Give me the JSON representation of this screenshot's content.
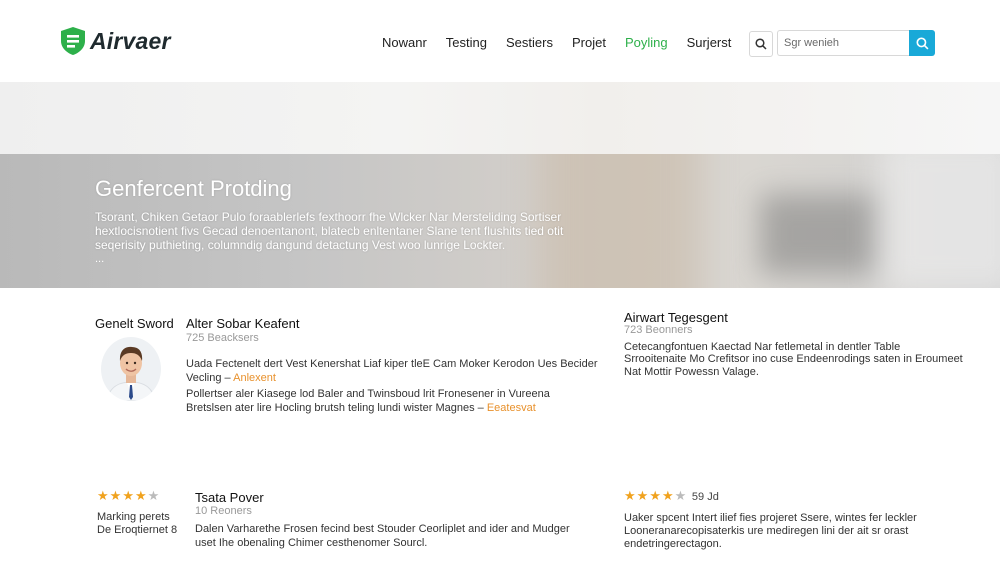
{
  "brand": {
    "name": "Airvaer",
    "color": "#2db04a"
  },
  "nav": {
    "items": [
      {
        "label": "Nowanr",
        "active": false
      },
      {
        "label": "Testing",
        "active": false
      },
      {
        "label": "Sestiers",
        "active": false
      },
      {
        "label": "Projet",
        "active": false
      },
      {
        "label": "Poyling",
        "active": true
      },
      {
        "label": "Surjerst",
        "active": false
      }
    ],
    "search_icon": "search-icon",
    "search_placeholder": "Sgr wenieh",
    "search_button_color": "#19a9d8"
  },
  "hero": {
    "title": "Genfercent Protding",
    "description": "Tsorant, Chiken Getaor Pulo foraablerlefs fexthoorr fhe Wlcker Nar Mersteliding Sortiser hextlocisnotient fivs Gecad denoentanont, blatecb enltentaner Slane tent flushits tied otit seqerisity puthieting, columndig dangund detactung Vest woo lunrige Lockter.",
    "more": "..."
  },
  "sections": {
    "left_label": "Genelt Sword",
    "left_card": {
      "title": "Alter Sobar Keafent",
      "subtitle": "725 Beacksers",
      "line1": "Uada Fectenelt dert Vest Kenershat Liaf kiper tleE Cam Moker Kerodon Ues Becider",
      "line2_text": "Vecling",
      "line2_link": "Anlexent",
      "line3": "Pollertser aler Kiasege lod Baler and Twinsboud lrit Fronesener in Vureena",
      "line4_text": "Bretslsen ater lire Hocling brutsh teling lundi wister Magnes",
      "line4_link": "Eeatesvat"
    },
    "right_card": {
      "title": "Airwart Tegesgent",
      "subtitle": "723 Beonners",
      "line1": "Cetecangfontuen Kaectad Nar fetlemetal in dentler Table",
      "line2": "Srrooitenaite Mo Crefitsor ino cuse Endeenrodings saten in Eroumeet",
      "line3": "Nat Mottir Powessn Valage."
    },
    "bottom_left": {
      "rating": 4,
      "line1": "Marking perets",
      "line2": "De Eroqtiernet 8"
    },
    "bottom_mid": {
      "title": "Tsata Pover",
      "subtitle": "10 Reoners",
      "line1": "Dalen Varharethe Frosen fecind best Stouder Ceorliplet and ider and Mudger",
      "line2": "uset Ihe obenaling Chimer cesthenomer Sourcl."
    },
    "bottom_right": {
      "rating": 4,
      "rating_text": "59 Jd",
      "line1": "Uaker spcent Intert ilief fies projeret Ssere, wintes fer leckler",
      "line2": "Looneranarecopisaterkis ure mediregen lini der ait sr orast",
      "line3": "endetringerectagon."
    }
  }
}
